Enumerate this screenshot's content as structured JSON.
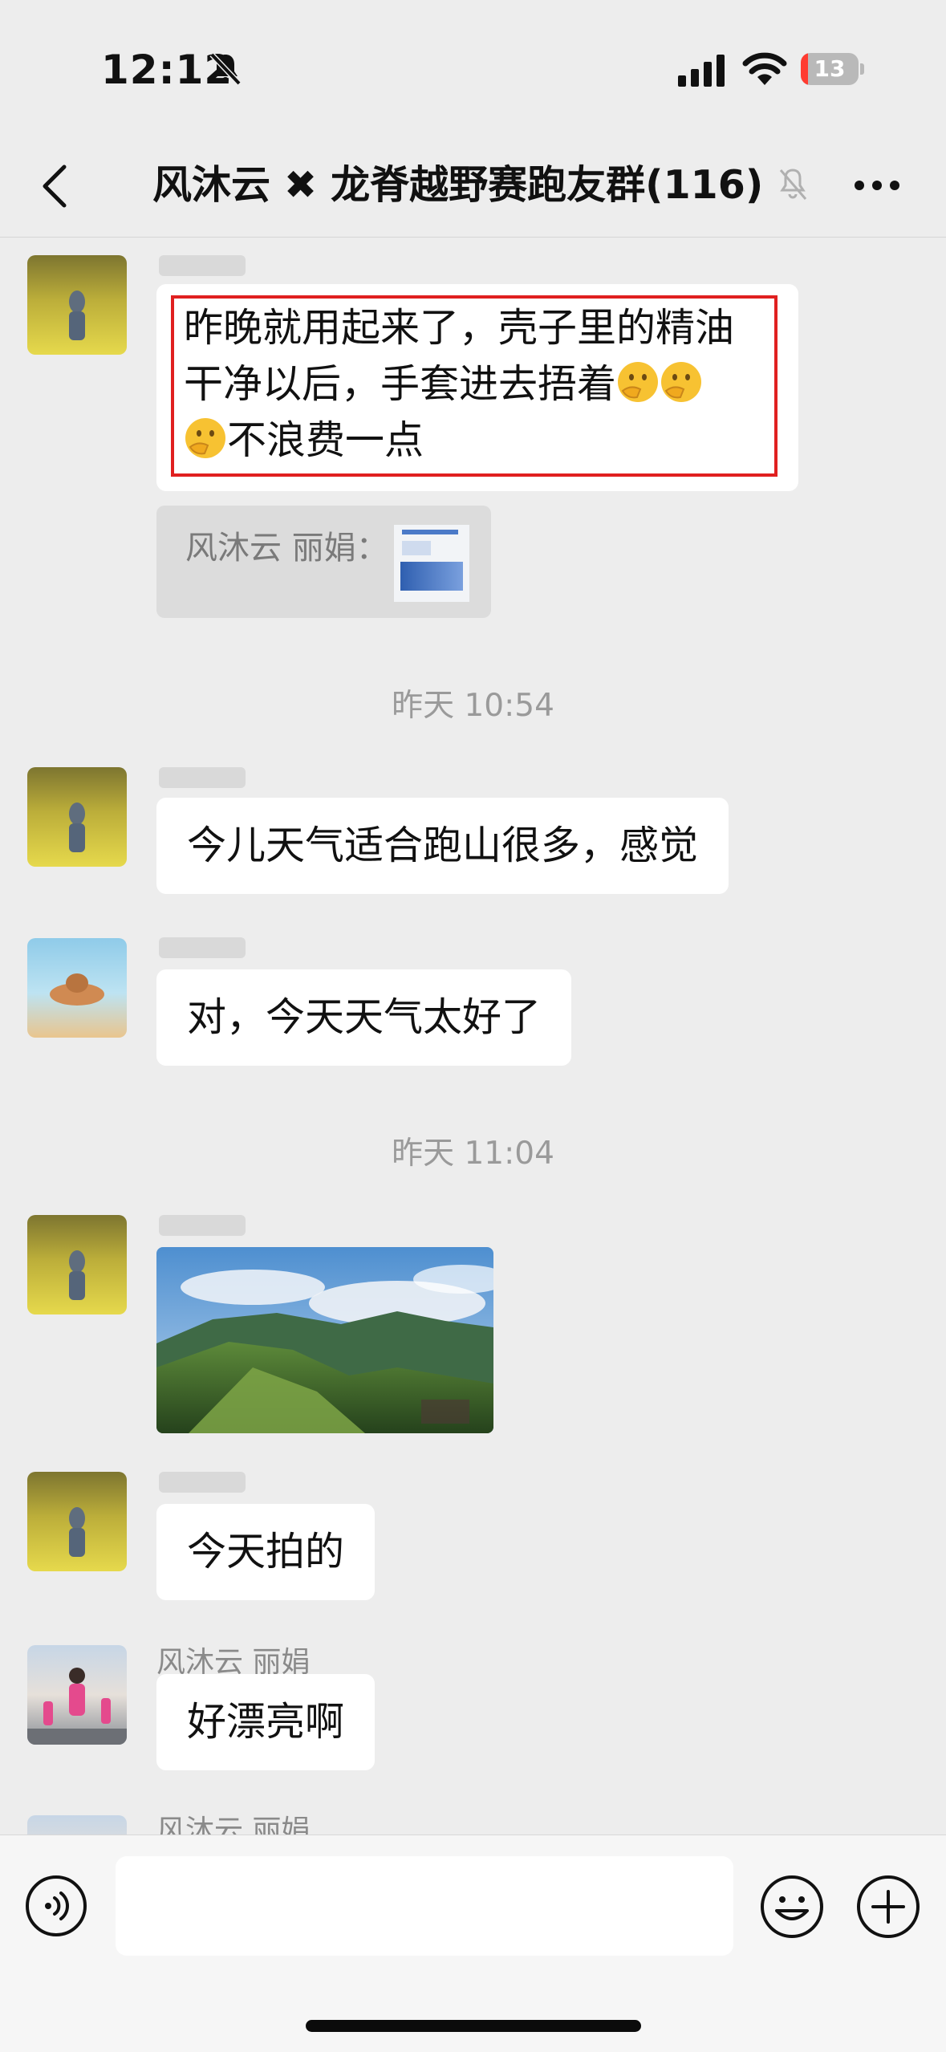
{
  "status_bar": {
    "time": "12:12",
    "battery_level": "13",
    "battery_fraction": 0.13,
    "battery_fill_color": "#ff3b30",
    "icons": [
      "bell-slash-icon",
      "cellular-signal-icon",
      "wifi-icon",
      "battery-icon"
    ]
  },
  "nav": {
    "title": "风沐云 ✖ 龙脊越野赛跑友群(116)",
    "icons": [
      "back-chevron-icon",
      "bell-slash-icon",
      "more-dots-icon"
    ]
  },
  "messages": [
    {
      "text_line1": "昨晚就用起来了，壳子里的精油",
      "text_line2": "干净以后，手套进去捂着",
      "text_line3": "不浪费一点",
      "emoji": "thinking-face-icon",
      "highlight_color": "#e02020",
      "quote_sender": "风沐云 丽娟："
    },
    {
      "timestamp": "昨天 10:54"
    },
    {
      "text": "今儿天气适合跑山很多，感觉"
    },
    {
      "text": "对，今天天气太好了"
    },
    {
      "timestamp": "昨天 11:04"
    },
    {
      "image": "mountain-photo"
    },
    {
      "text": "今天拍的"
    },
    {
      "sender": "风沐云 丽娟",
      "text": "好漂亮啊"
    },
    {
      "sender": "风沐云 丽娟"
    }
  ],
  "input_bar": {
    "icons": [
      "voice-icon",
      "emoji-icon",
      "plus-icon"
    ]
  }
}
